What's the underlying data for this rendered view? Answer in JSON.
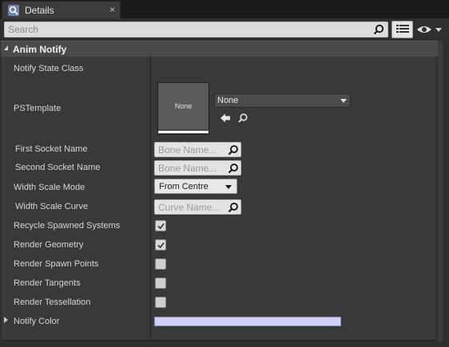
{
  "tab": {
    "title": "Details",
    "close_glyph": "×"
  },
  "search": {
    "placeholder": "Search"
  },
  "category": {
    "title": "Anim Notify"
  },
  "properties": {
    "notify_state_class": "Notify State Class",
    "pstemplate": "PSTemplate",
    "pstemplate_thumb": "None",
    "pstemplate_value": "None",
    "first_socket_name": "First Socket Name",
    "first_socket_placeholder": "Bone Name...",
    "second_socket_name": "Second Socket Name",
    "second_socket_placeholder": "Bone Name...",
    "width_scale_mode": "Width Scale Mode",
    "width_scale_mode_value": "From Centre",
    "width_scale_curve": "Width Scale Curve",
    "width_scale_curve_placeholder": "Curve Name...",
    "recycle_spawned_systems": "Recycle Spawned Systems",
    "recycle_spawned_systems_checked": true,
    "render_geometry": "Render Geometry",
    "render_geometry_checked": true,
    "render_spawn_points": "Render Spawn Points",
    "render_spawn_points_checked": false,
    "render_tangents": "Render Tangents",
    "render_tangents_checked": false,
    "render_tessellation": "Render Tessellation",
    "render_tessellation_checked": false,
    "notify_color": "Notify Color",
    "notify_color_value": "#d0d0ff"
  },
  "icons": {
    "tab": "magnifier-icon",
    "search": "search-icon",
    "view_options": "list-view-icon",
    "visibility": "eye-icon",
    "use_selected": "arrow-left-icon",
    "browse": "search-icon"
  }
}
